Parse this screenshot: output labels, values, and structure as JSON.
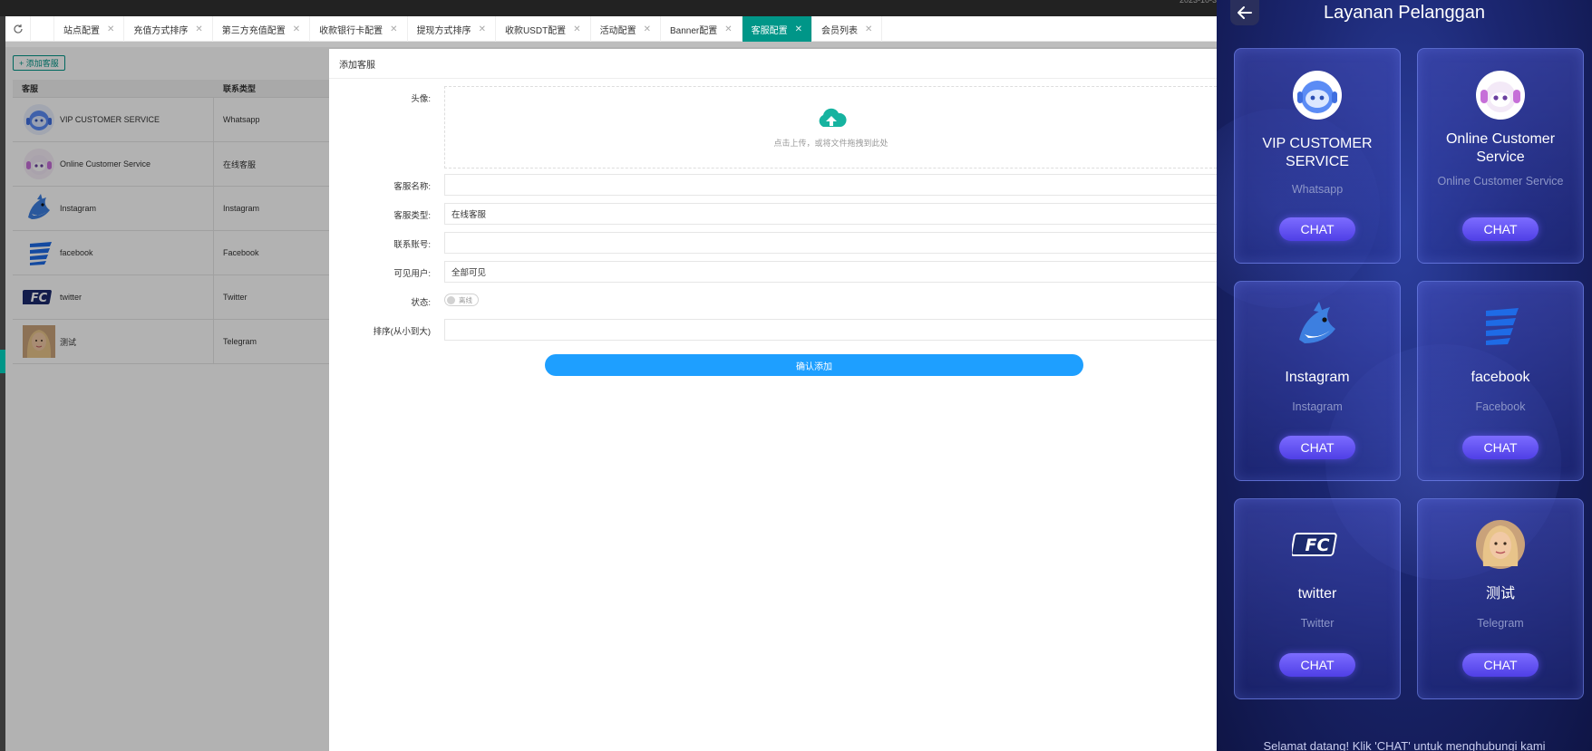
{
  "top_clip": "2023-10-3",
  "tabs": [
    {
      "label": "站点配置"
    },
    {
      "label": "充值方式排序"
    },
    {
      "label": "第三方充值配置"
    },
    {
      "label": "收款银行卡配置"
    },
    {
      "label": "提现方式排序"
    },
    {
      "label": "收款USDT配置"
    },
    {
      "label": "活动配置"
    },
    {
      "label": "Banner配置"
    },
    {
      "label": "客服配置",
      "active": true
    },
    {
      "label": "会员列表"
    }
  ],
  "toolbar": {
    "add_label": "+ 添加客服"
  },
  "table": {
    "headers": [
      "客服",
      "联系类型"
    ],
    "rows": [
      {
        "name": "VIP CUSTOMER SERVICE",
        "type": "Whatsapp",
        "avatar": "robot-headset-blue"
      },
      {
        "name": "Online Customer Service",
        "type": "在线客服",
        "avatar": "robot-headset-pink"
      },
      {
        "name": "Instagram",
        "type": "Instagram",
        "avatar": "shark-mascot"
      },
      {
        "name": "facebook",
        "type": "Facebook",
        "avatar": "blue-stripes-logo"
      },
      {
        "name": "twitter",
        "type": "Twitter",
        "avatar": "fc-logo"
      },
      {
        "name": "测试",
        "type": "Telegram",
        "avatar": "blonde-woman-portrait"
      }
    ]
  },
  "modal": {
    "title": "添加客服",
    "avatar_label": "头像:",
    "upload_hint": "点击上传，或将文件拖拽到此处",
    "name_label": "客服名称:",
    "name_value": "",
    "type_label": "客服类型:",
    "type_value": "在线客服",
    "account_label": "联系账号:",
    "account_value": "",
    "visible_label": "可见用户:",
    "visible_value": "全部可见",
    "status_label": "状态:",
    "status_value": "离线",
    "sort_label": "排序(从小到大)",
    "sort_value": "",
    "confirm_label": "确认添加"
  },
  "mobile": {
    "title": "Layanan Pelanggan",
    "cards": [
      {
        "name": "VIP CUSTOMER SERVICE",
        "type": "Whatsapp",
        "button": "CHAT",
        "icon": "robot-headset-blue"
      },
      {
        "name": "Online Customer Service",
        "type": "Online Customer Service",
        "button": "CHAT",
        "icon": "robot-headset-pink"
      },
      {
        "name": "Instagram",
        "type": "Instagram",
        "button": "CHAT",
        "icon": "shark-mascot"
      },
      {
        "name": "facebook",
        "type": "Facebook",
        "button": "CHAT",
        "icon": "blue-stripes-logo"
      },
      {
        "name": "twitter",
        "type": "Twitter",
        "button": "CHAT",
        "icon": "fc-logo"
      },
      {
        "name": "测试",
        "type": "Telegram",
        "button": "CHAT",
        "icon": "blonde-woman-portrait"
      }
    ],
    "footer": "Selamat datang! Klik 'CHAT' untuk menghubungi kami"
  },
  "colors": {
    "accent": "#009688",
    "confirm": "#1e9fff",
    "chat_button": "#5b4cf0"
  }
}
